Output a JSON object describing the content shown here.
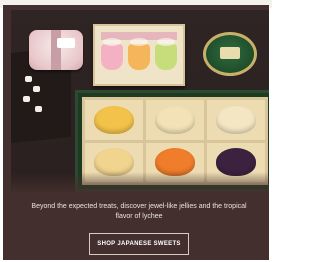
{
  "promo": {
    "image_alt": "Assortment of Japanese sweets and jellies in boxes",
    "caption": "Beyond the expected treats, discover jewel-like jellies and the tropical flavor of lychee",
    "cta_label": "SHOP JAPANESE SWEETS"
  },
  "colors": {
    "panel_background": "#43302e",
    "caption_text": "#ece3de",
    "button_border": "#d9cbc4",
    "jelly_yellow": "#f2c24a",
    "jelly_orange": "#ef7d2b",
    "jelly_purple": "#3d2240",
    "jelly_cream": "#f1d58f",
    "cup_pink": "#f3b1c3",
    "cup_orange": "#f5b55b",
    "cup_green": "#c7dc7a"
  }
}
